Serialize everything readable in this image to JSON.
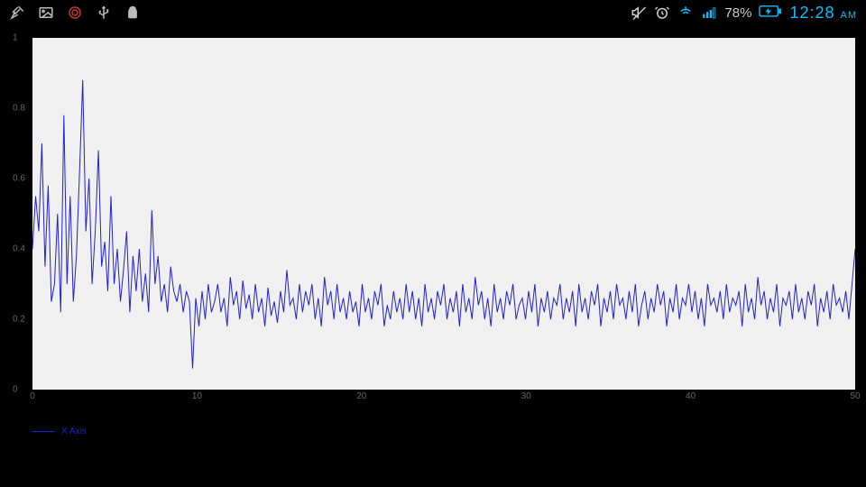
{
  "statusbar": {
    "battery_pct": "78%",
    "clock": "12:28",
    "ampm": "AM"
  },
  "chart_data": {
    "type": "line",
    "title": "",
    "xlabel": "",
    "ylabel": "",
    "xlim": [
      0,
      50
    ],
    "ylim": [
      0,
      1
    ],
    "xticks": [
      0,
      10,
      20,
      30,
      40,
      50
    ],
    "yticks": [
      0,
      0.2,
      0.4,
      0.6,
      0.8,
      1
    ],
    "legend": "X Axis",
    "series": [
      {
        "name": "X Axis",
        "color": "#2020d0",
        "x_step": 50,
        "values": [
          0.4,
          0.55,
          0.45,
          0.7,
          0.35,
          0.58,
          0.25,
          0.3,
          0.5,
          0.22,
          0.78,
          0.3,
          0.55,
          0.25,
          0.38,
          0.62,
          0.88,
          0.45,
          0.6,
          0.3,
          0.45,
          0.68,
          0.35,
          0.42,
          0.28,
          0.55,
          0.3,
          0.4,
          0.25,
          0.34,
          0.45,
          0.22,
          0.38,
          0.28,
          0.4,
          0.25,
          0.33,
          0.22,
          0.51,
          0.3,
          0.38,
          0.25,
          0.3,
          0.22,
          0.35,
          0.28,
          0.25,
          0.3,
          0.22,
          0.28,
          0.25,
          0.06,
          0.26,
          0.18,
          0.28,
          0.2,
          0.3,
          0.22,
          0.25,
          0.3,
          0.22,
          0.26,
          0.18,
          0.32,
          0.24,
          0.28,
          0.2,
          0.31,
          0.23,
          0.27,
          0.2,
          0.3,
          0.22,
          0.26,
          0.18,
          0.29,
          0.21,
          0.25,
          0.19,
          0.28,
          0.22,
          0.34,
          0.24,
          0.26,
          0.2,
          0.3,
          0.22,
          0.28,
          0.24,
          0.3,
          0.2,
          0.26,
          0.18,
          0.32,
          0.24,
          0.28,
          0.2,
          0.3,
          0.22,
          0.26,
          0.2,
          0.28,
          0.22,
          0.25,
          0.18,
          0.3,
          0.22,
          0.26,
          0.2,
          0.28,
          0.24,
          0.3,
          0.18,
          0.24,
          0.2,
          0.28,
          0.22,
          0.26,
          0.2,
          0.3,
          0.22,
          0.28,
          0.2,
          0.26,
          0.18,
          0.3,
          0.22,
          0.26,
          0.2,
          0.28,
          0.24,
          0.3,
          0.2,
          0.26,
          0.22,
          0.28,
          0.18,
          0.3,
          0.22,
          0.26,
          0.2,
          0.32,
          0.24,
          0.28,
          0.2,
          0.26,
          0.18,
          0.3,
          0.22,
          0.26,
          0.2,
          0.28,
          0.24,
          0.3,
          0.2,
          0.24,
          0.26,
          0.2,
          0.28,
          0.22,
          0.3,
          0.18,
          0.26,
          0.22,
          0.28,
          0.2,
          0.26,
          0.24,
          0.3,
          0.2,
          0.26,
          0.22,
          0.28,
          0.18,
          0.3,
          0.22,
          0.26,
          0.2,
          0.28,
          0.24,
          0.3,
          0.18,
          0.26,
          0.22,
          0.28,
          0.2,
          0.3,
          0.24,
          0.26,
          0.2,
          0.28,
          0.22,
          0.3,
          0.18,
          0.24,
          0.28,
          0.2,
          0.26,
          0.22,
          0.3,
          0.24,
          0.28,
          0.18,
          0.26,
          0.22,
          0.3,
          0.2,
          0.26,
          0.24,
          0.3,
          0.22,
          0.28,
          0.2,
          0.26,
          0.18,
          0.3,
          0.24,
          0.26,
          0.22,
          0.28,
          0.2,
          0.3,
          0.22,
          0.26,
          0.24,
          0.28,
          0.18,
          0.3,
          0.22,
          0.26,
          0.2,
          0.32,
          0.24,
          0.28,
          0.2,
          0.26,
          0.22,
          0.3,
          0.18,
          0.26,
          0.24,
          0.28,
          0.2,
          0.3,
          0.22,
          0.26,
          0.2,
          0.28,
          0.24,
          0.3,
          0.18,
          0.26,
          0.22,
          0.28,
          0.2,
          0.3,
          0.24,
          0.26,
          0.22,
          0.28,
          0.2,
          0.3,
          0.4
        ]
      }
    ]
  }
}
